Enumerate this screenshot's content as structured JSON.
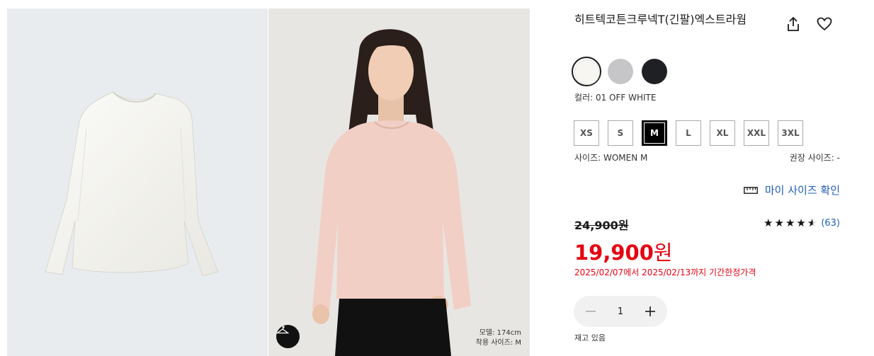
{
  "product": {
    "title": "히트텍코튼크루넥T(긴팔)엑스트라웜"
  },
  "gallery": {
    "model_height": "모델: 174cm",
    "model_size": "착용 사이즈: M"
  },
  "colors": {
    "label": "컬러: 01 OFF WHITE",
    "swatches": [
      {
        "name": "OFF WHITE",
        "hex": "#f7f6f1",
        "selected": true
      },
      {
        "name": "GRAY",
        "hex": "#c6c6c8",
        "selected": false
      },
      {
        "name": "BLACK",
        "hex": "#1f2024",
        "selected": false
      }
    ]
  },
  "sizes": {
    "options": [
      "XS",
      "S",
      "M",
      "L",
      "XL",
      "XXL",
      "3XL"
    ],
    "selected": "M",
    "label": "사이즈: WOMEN M",
    "recommended": "권장 사이즈: -"
  },
  "my_size": {
    "label": "마이 사이즈 확인"
  },
  "pricing": {
    "original": "24,900원",
    "current_number": "19,900",
    "currency": "원",
    "promo": "2025/02/07에서 2025/02/13까지 기간한정가격"
  },
  "rating": {
    "stars": "★★★★★",
    "value": 4.5,
    "count": "(63)"
  },
  "quantity": {
    "value": "1"
  },
  "stock": {
    "label": "재고 있음"
  },
  "theme": {
    "accent_red": "#e60012",
    "link_blue": "#1f5db8"
  }
}
